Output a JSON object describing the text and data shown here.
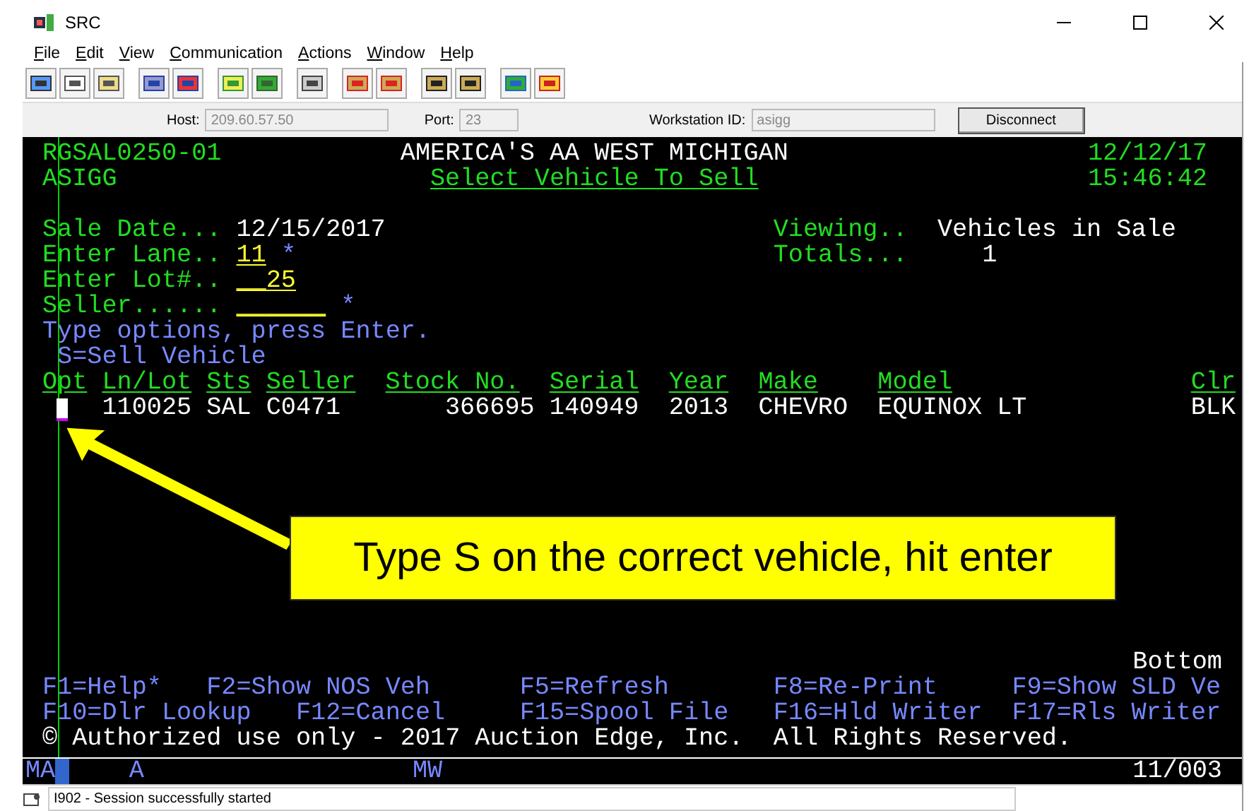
{
  "window": {
    "title": "SRC"
  },
  "menu": [
    "File",
    "Edit",
    "View",
    "Communication",
    "Actions",
    "Window",
    "Help"
  ],
  "connection": {
    "host_label": "Host:",
    "host": "209.60.57.50",
    "port_label": "Port:",
    "port": "23",
    "workstation_label": "Workstation ID:",
    "workstation": "asigg",
    "button": "Disconnect"
  },
  "terminal": {
    "header": {
      "program": "RGSAL0250-01",
      "company": "AMERICA'S AA WEST MICHIGAN",
      "date": "12/12/17",
      "user": "ASIGG",
      "screen_title": "Select Vehicle To Sell",
      "time": "15:46:42"
    },
    "fields": [
      {
        "kind": "display",
        "label": "Sale Date...",
        "value": "12/15/2017",
        "side_label": "Viewing..",
        "side_value": "Vehicles in Sale"
      },
      {
        "kind": "input",
        "label": "Enter Lane..",
        "value": "11",
        "marker": "*",
        "side_label": "Totals...",
        "side_value": "1"
      },
      {
        "kind": "input",
        "label": "Enter Lot#..",
        "value": "__25"
      },
      {
        "kind": "input",
        "label": "Seller......",
        "value": "______",
        "marker": "*"
      }
    ],
    "instructions": "Type options, press Enter.",
    "options": "S=Sell Vehicle",
    "columns": [
      "Opt",
      "Ln/Lot",
      "Sts",
      "Seller",
      "Stock No.",
      "Serial",
      "Year",
      "Make",
      "Model",
      "Clr"
    ],
    "rows": [
      {
        "cells": [
          "",
          "110025",
          "SAL",
          "C0471",
          "366695",
          "140949",
          "2013",
          "CHEVRO",
          "EQUINOX LT",
          "BLK"
        ]
      }
    ],
    "more": "Bottom",
    "function_keys": [
      [
        "F1=Help*",
        "F2=Show NOS Veh",
        "F5=Refresh",
        "F8=Re-Print",
        "F9=Show SLD Ve"
      ],
      [
        "F10=Dlr Lookup",
        "F12=Cancel",
        "F15=Spool File",
        "F16=Hld Writer",
        "F17=Rls Writer"
      ]
    ],
    "copyright": "© Authorized use only - 2017 Auction Edge, Inc.  All Rights Reserved.",
    "status_line": {
      "mode": "MA",
      "indicator": "A",
      "keyboard": "MW",
      "cursor": "11/003"
    }
  },
  "callout": "Type S on the correct vehicle, hit enter",
  "status_bar": {
    "message": "I902 - Session successfully started"
  }
}
